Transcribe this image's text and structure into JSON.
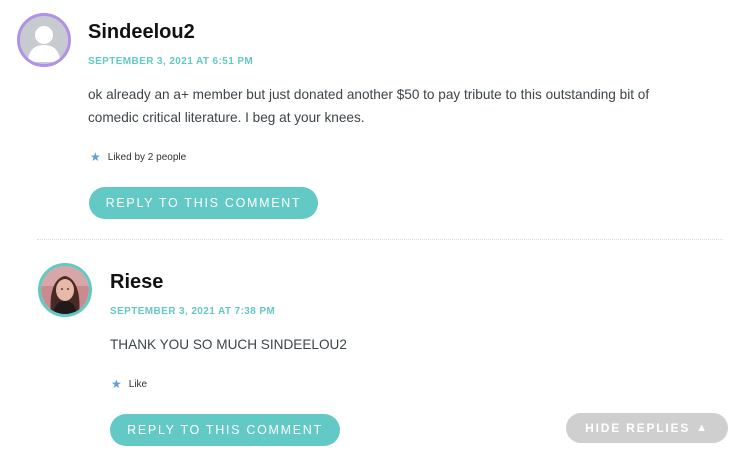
{
  "colors": {
    "accent": "#62c9c5",
    "avatar_ring_purple": "#b190e8",
    "avatar_ring_teal": "#5ec9c5",
    "hide_button_bg": "#cfcfcf",
    "star": "#5e9fd6"
  },
  "comments": [
    {
      "author": "Sindeelou2",
      "timestamp": "SEPTEMBER 3, 2021 AT 6:51 PM",
      "body": "ok already an a+ member but just donated another $50 to pay tribute to this outstanding bit of comedic critical literature. I beg at your knees.",
      "like_text": "Liked by 2 people",
      "reply_label": "REPLY TO THIS COMMENT",
      "avatar_icon": "default-user-avatar"
    },
    {
      "author": "Riese",
      "timestamp": "SEPTEMBER 3, 2021 AT 7:38 PM",
      "body": "THANK YOU SO MUCH SINDEELOU2",
      "like_text": "Like",
      "reply_label": "REPLY TO THIS COMMENT",
      "avatar_icon": "user-photo-avatar"
    }
  ],
  "hide_replies_label": "HIDE REPLIES"
}
